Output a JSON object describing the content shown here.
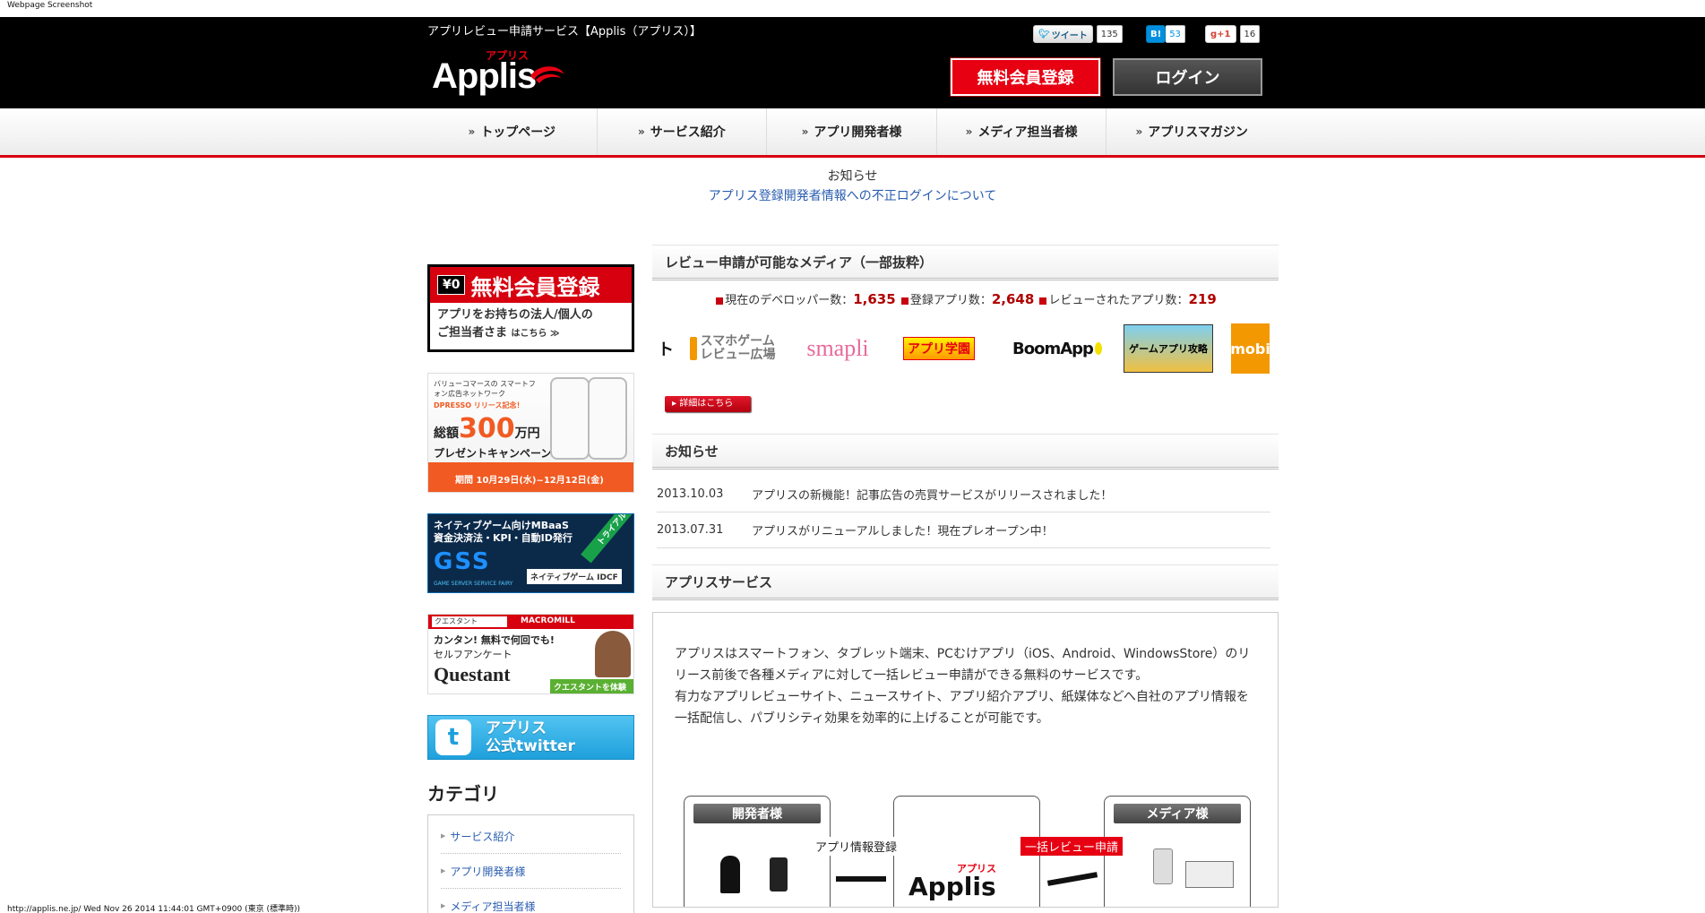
{
  "screenshot": {
    "label": "Webpage Screenshot",
    "footer": "http://applis.ne.jp/ Wed Nov 26 2014 11:44:01 GMT+0900 (東京 (標準時))"
  },
  "header": {
    "tagline": "アプリレビュー申請サービス【Applis（アプリス）】",
    "logo_word": "Applis",
    "logo_kana": "アプリス",
    "social": {
      "tweet_label": "ツイート",
      "tweet_count": "135",
      "hatena_label": "B!",
      "hatena_count": "53",
      "gplus_label": "g+1",
      "gplus_count": "16"
    },
    "register_label": "無料会員登録",
    "login_label": "ログイン"
  },
  "nav": {
    "items": [
      {
        "label": "トップページ"
      },
      {
        "label": "サービス紹介"
      },
      {
        "label": "アプリ開発者様"
      },
      {
        "label": "メディア担当者様"
      },
      {
        "label": "アプリスマガジン"
      }
    ]
  },
  "top_notice": {
    "heading": "お知らせ",
    "link": "アプリス登録開発者情報への不正ログインについて"
  },
  "sidebar": {
    "register_banner": {
      "yen": "¥0",
      "title": "無料会員登録",
      "line1": "アプリをお持ちの法人/個人の",
      "line2": "ご担当者さま",
      "link": "はこちら ≫"
    },
    "dpresso_banner": {
      "intro": "バリューコマースの スマートフォン広告ネットワーク",
      "brand": "DPRESSO リリース記念！",
      "total_prefix": "総額",
      "total_amount": "300",
      "total_suffix": "万円",
      "campaign": "プレゼントキャンペーン！",
      "period": "期間  10月29日(水)~12月12日(金)"
    },
    "gss_banner": {
      "line1": "ネイティブゲーム向けMBaaS",
      "line2": "資金決済法・KPI・自動ID発行",
      "logo": "GSS",
      "sub": "GAME SERVER SERVICE FAIRY",
      "idcf": "ネイティブゲーム  IDCF",
      "trial": "トライアル"
    },
    "questant_banner": {
      "search_box": "クエスタント",
      "brand": "MACROMILL",
      "line1": "カンタン! 無料で何回でも!",
      "line2": "セルフアンケート",
      "logo": "Questant",
      "try": "クエスタントを体験 >"
    },
    "twitter_banner": {
      "line1": "アプリス",
      "line2": "公式twitter"
    },
    "category_title": "カテゴリ",
    "categories": [
      {
        "label": "サービス紹介"
      },
      {
        "label": "アプリ開発者様"
      },
      {
        "label": "メディア担当者様"
      }
    ]
  },
  "main": {
    "media_section": {
      "title": "レビュー申請が可能なメディア（一部抜粋）",
      "stats": {
        "dev_label": "現在のデベロッパー数：",
        "dev_count": "1,635",
        "app_label": "登録アプリ数：",
        "app_count": "2,648",
        "review_label": "レビューされたアプリ数：",
        "review_count": "219"
      },
      "logos": [
        {
          "name": "スマホゲーム レビュー広場"
        },
        {
          "name": "smapli"
        },
        {
          "name": "アプリ学園"
        },
        {
          "name": "BoomApp"
        },
        {
          "name": "ゲームアプリ攻略"
        },
        {
          "name": "mobi"
        }
      ],
      "detail_label": "▸ 詳細はこちら"
    },
    "news_section": {
      "title": "お知らせ",
      "items": [
        {
          "date": "2013.10.03",
          "text": "アプリスの新機能！記事広告の売買サービスがリリースされました！"
        },
        {
          "date": "2013.07.31",
          "text": "アプリスがリニューアルしました！現在プレオープン中！"
        }
      ]
    },
    "service_section": {
      "title": "アプリスサービス",
      "para1": "アプリスはスマートフォン、タブレット端末、PCむけアプリ（iOS、Android、WindowsStore）のリリース前後で各種メディアに対して一括レビュー申請ができる無料のサービスです。",
      "para2": "有力なアプリレビューサイト、ニュースサイト、アプリ紹介アプリ、紙媒体などへ自社のアプリ情報を一括配信し、パブリシティ効果を効率的に上げることが可能です。",
      "flow": {
        "dev_label": "開発者様",
        "media_label": "メディア様",
        "step1": "アプリ情報登録",
        "step2": "一括レビュー申請",
        "app_word": "Applis",
        "app_kana": "アプリス"
      }
    }
  },
  "colors": {
    "brand_red": "#e60012",
    "link_blue": "#2a5db0",
    "header_black": "#000000"
  }
}
